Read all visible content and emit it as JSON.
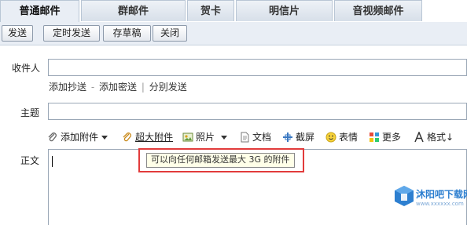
{
  "tabs": [
    {
      "label": "普通邮件"
    },
    {
      "label": "群邮件"
    },
    {
      "label": "贺卡"
    },
    {
      "label": "明信片"
    },
    {
      "label": "音视频邮件"
    }
  ],
  "toolbar": {
    "send": "发送",
    "scheduled_send": "定时发送",
    "save_draft": "存草稿",
    "close": "关闭"
  },
  "form": {
    "recipient_label": "收件人",
    "recipient_value": "",
    "add_cc": "添加抄送",
    "link_sep": "-",
    "add_bcc": "添加密送",
    "separator": "|",
    "send_separately": "分别发送",
    "subject_label": "主题",
    "subject_value": "",
    "body_label": "正文"
  },
  "body_toolbar": {
    "add_attachment": "添加附件",
    "super_attachment": "超大附件",
    "photo": "照片",
    "document": "文档",
    "screenshot": "截屏",
    "emoji": "表情",
    "more": "更多",
    "format": "格式↓"
  },
  "tooltip": {
    "text": "可以向任何邮箱发送最大 3G 的附件"
  },
  "watermark": {
    "title": "沐阳吧下载网",
    "url": "www.xxxxxx.com"
  },
  "colors": {
    "highlight_border": "#e23b3b",
    "tab_bg": "#dbe3ec",
    "toolbar_bg": "#e9eef5"
  }
}
